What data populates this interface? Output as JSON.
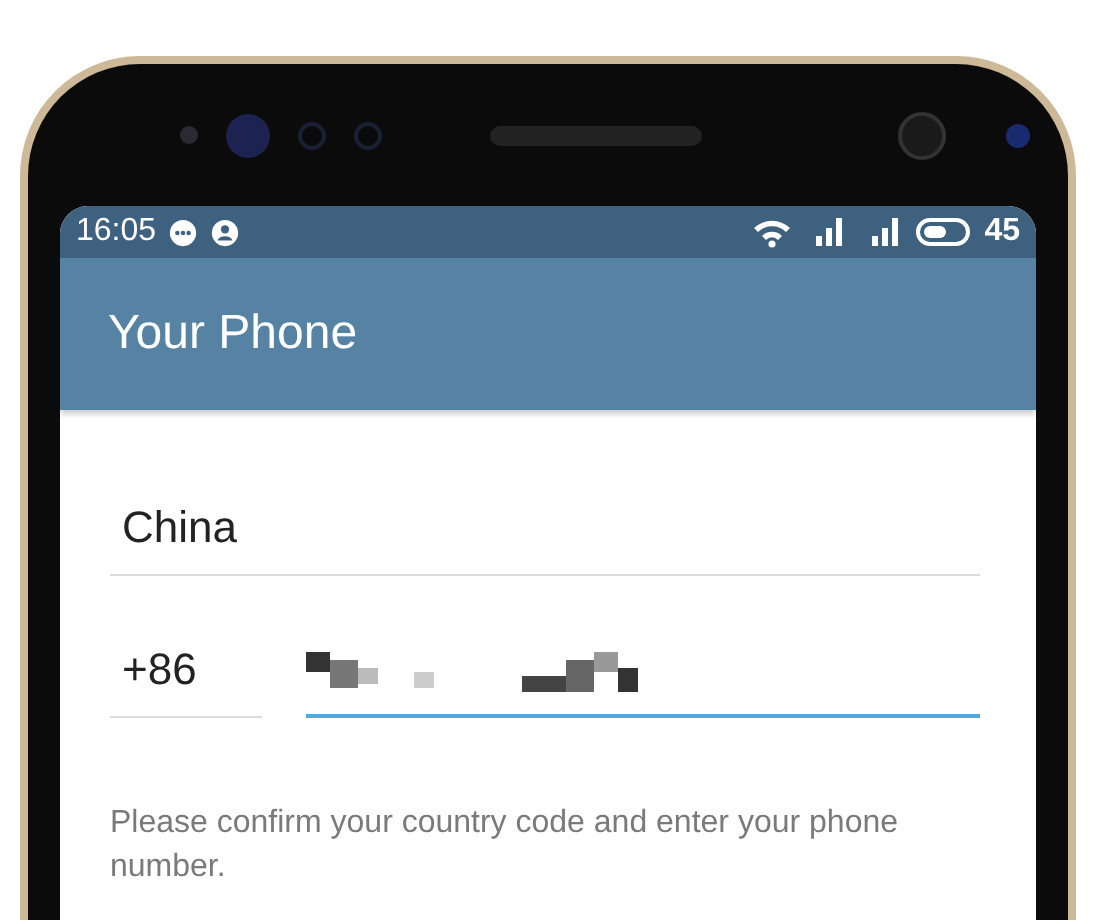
{
  "status_bar": {
    "time": "16:05",
    "battery": "45"
  },
  "app_bar": {
    "title": "Your Phone"
  },
  "country_field": {
    "value": "China"
  },
  "code_field": {
    "value": "+86"
  },
  "phone_field": {
    "focused": true
  },
  "hint": "Please confirm your country code and enter your phone number."
}
